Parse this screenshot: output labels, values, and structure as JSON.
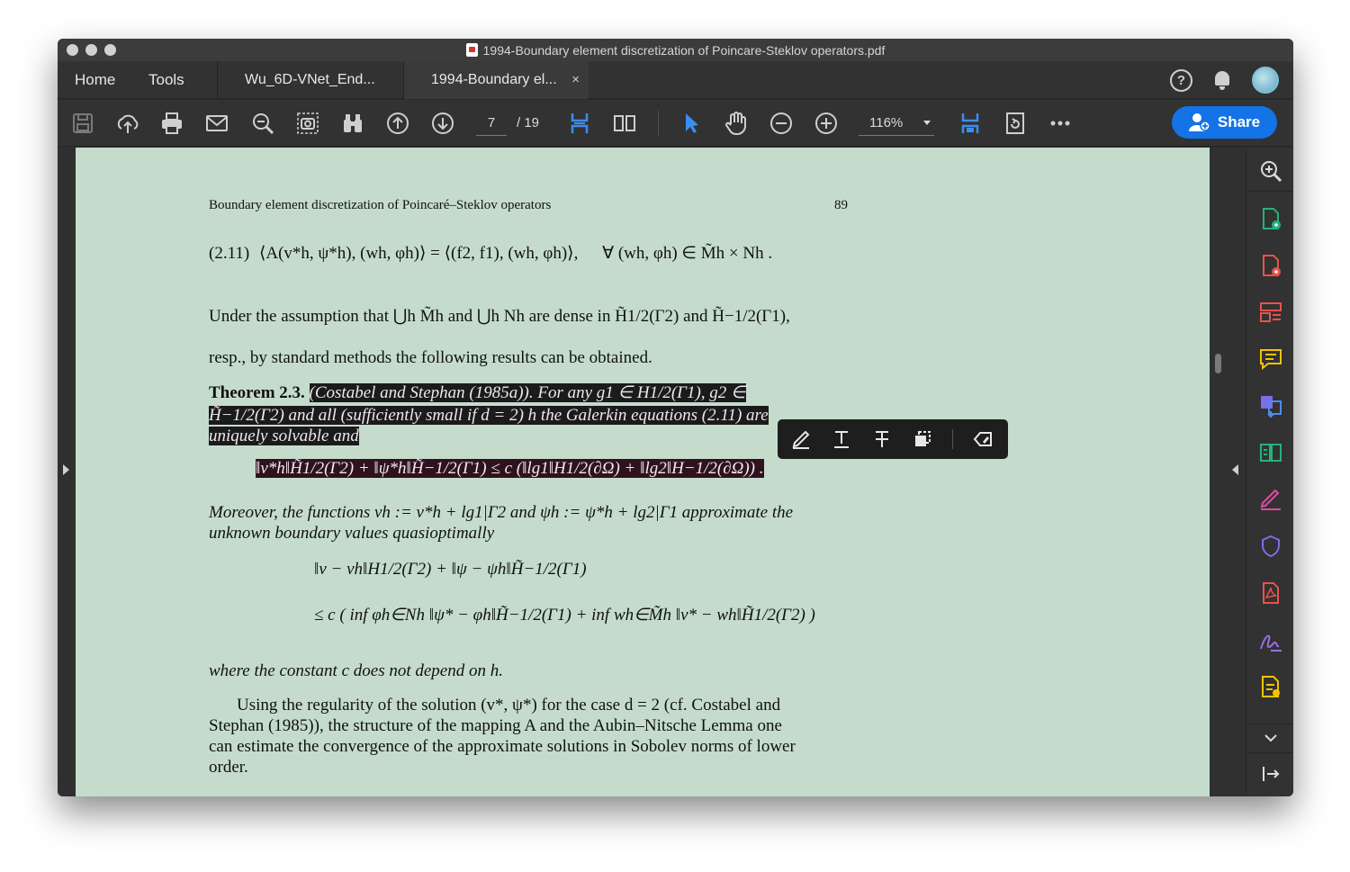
{
  "window": {
    "title": "1994-Boundary element discretization of Poincare-Steklov operators.pdf"
  },
  "tabs": {
    "home": "Home",
    "tools": "Tools",
    "doc1": "Wu_6D-VNet_End...",
    "doc2": "1994-Boundary el...",
    "close": "×"
  },
  "toolbar": {
    "current_page": "7",
    "total_pages": "/ 19",
    "zoom": "116%",
    "share_label": "Share"
  },
  "document": {
    "running_head": "Boundary element discretization of Poincaré–Steklov operators",
    "page_number": "89",
    "eq_label": "(2.11)",
    "eq_body": "⟨A(v*h, ψ*h), (wh, φh)⟩ = ⟨(f2, f1), (wh, φh)⟩,",
    "eq_condition": "∀ (wh, φh) ∈ M̃h × Nh .",
    "para1_line1": "Under the assumption that ⋃h M̃h and ⋃h Nh are dense in H̃1/2(Γ2) and H̃−1/2(Γ1),",
    "para1_line2": "resp., by standard methods the following results can be obtained.",
    "theorem_label": "Theorem 2.3.",
    "theorem_text_1": "(Costabel and Stephan (1985a)). For any g1 ∈ H1/2(Γ1), g2 ∈",
    "theorem_text_2": "H̃−1/2(Γ2) and all (sufficiently small if d = 2) h the Galerkin equations (2.11) are",
    "theorem_text_3": "uniquely solvable and",
    "theorem_bound": "‖v*h‖H̃1/2(Γ2) + ‖ψ*h‖H̃−1/2(Γ1) ≤ c (‖lg1‖H1/2(∂Ω) + ‖lg2‖H−1/2(∂Ω)) .",
    "moreover_1": "Moreover, the functions vh := v*h + lg1|Γ2 and ψh := ψ*h + lg2|Γ1 approximate the",
    "moreover_2": "unknown boundary values quasioptimally",
    "est_line1": "‖v − vh‖H1/2(Γ2) + ‖ψ − ψh‖H̃−1/2(Γ1)",
    "est_line2": "≤ c ( inf φh∈Nh ‖ψ* − φh‖H̃−1/2(Γ1) + inf wh∈M̃h ‖v* − wh‖H̃1/2(Γ2) )",
    "where_line": "where the constant c does not depend on h.",
    "para2_1": "Using the regularity of the solution (v*, ψ*) for the case d = 2 (cf. Costabel and",
    "para2_2": "Stephan (1985)), the structure of the mapping A and the Aubin–Nitsche Lemma one",
    "para2_3": "can estimate the convergence of the approximate solutions in Sobolev norms of lower",
    "para2_4": "order."
  },
  "icons": [
    "save-icon",
    "upload-icon",
    "print-icon",
    "mail-icon",
    "zoom-out-search-icon",
    "screenshot-icon",
    "binoculars-icon",
    "page-up-icon",
    "page-down-icon",
    "fit-width-icon",
    "two-page-icon",
    "select-arrow-icon",
    "hand-icon",
    "zoom-minus-icon",
    "zoom-plus-icon",
    "fit-page-icon",
    "rotate-icon",
    "more-icon",
    "help-icon",
    "bell-icon",
    "avatar"
  ],
  "colors": {
    "accent": "#1473e6",
    "doc_background": "#c5dccd",
    "selection": "#1b1b1b"
  }
}
